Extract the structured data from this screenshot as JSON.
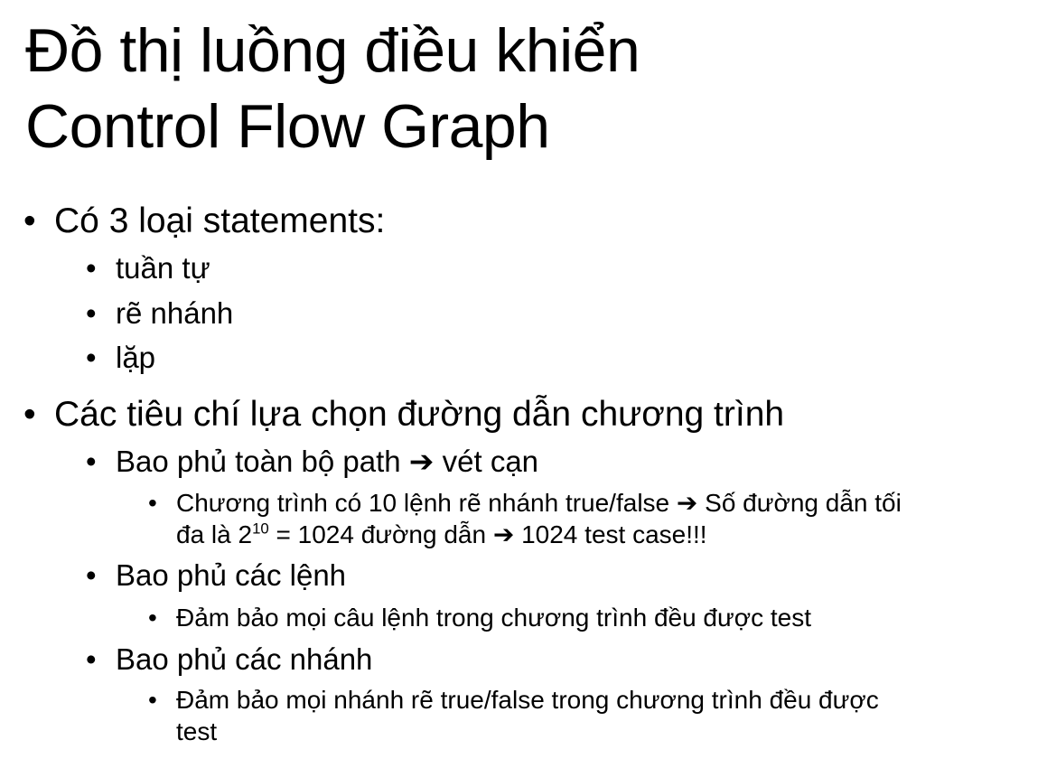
{
  "slide": {
    "title_line1": "Đồ thị luồng điều khiển",
    "title_line2": "Control Flow Graph",
    "bullet_char": "•",
    "arrow_char": "➔",
    "bullet1": {
      "text": "Có 3 loại statements:",
      "sub": [
        "tuần tự",
        "rẽ nhánh",
        "lặp"
      ]
    },
    "bullet2": {
      "text": "Các tiêu chí lựa chọn đường dẫn chương trình",
      "path": {
        "label": "Bao phủ toàn bộ path",
        "result": "vét cạn",
        "detail_part1": "Chương trình có 10 lệnh rẽ nhánh true/false",
        "detail_part2": "Số đường dẫn tối",
        "detail_part3": "đa là 2",
        "exponent": "10",
        "detail_part4": "= 1024 đường dẫn",
        "detail_part5": "1024 test case!!!"
      },
      "statements": {
        "label": "Bao phủ các lệnh",
        "detail": "Đảm bảo mọi câu lệnh trong chương trình đều được test"
      },
      "branches": {
        "label": "Bao phủ các nhánh",
        "detail_line1": "Đảm bảo mọi nhánh rẽ true/false trong chương trình đều được",
        "detail_line2": "test"
      }
    }
  }
}
